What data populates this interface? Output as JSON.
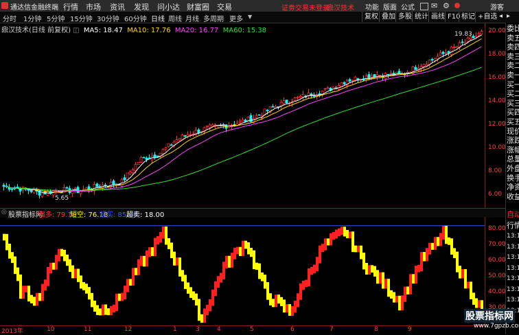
{
  "menubar": {
    "app_title": "通达信金融终端",
    "menus": [
      "行情",
      "市场",
      "资讯",
      "发现",
      "问小达",
      "财富圈",
      "交易"
    ],
    "warning": "证劵交易未登录",
    "indicator_name": "鼎汉技术",
    "right_items": [
      "功能",
      "版面",
      "公式"
    ],
    "guest": "游客"
  },
  "toolbar": {
    "periods": [
      "分时",
      "1分钟",
      "5分钟",
      "15分钟",
      "30分钟",
      "60分钟",
      "日线",
      "周线",
      "月线",
      "多周期",
      "更多"
    ],
    "active_period": "日线",
    "buttons": [
      "复权",
      "叠加",
      "多股",
      "统计",
      "画线",
      "F10",
      "标记",
      "+自选"
    ]
  },
  "chart": {
    "title": "鼎汉技术(日线 前复权)",
    "ma": [
      {
        "label": "MA5: 18.47",
        "color": "#ffffff"
      },
      {
        "label": "MA10: 17.76",
        "color": "#ffd700"
      },
      {
        "label": "MA20: 16.77",
        "color": "#ff44ff"
      },
      {
        "label": "MA60: 15.38",
        "color": "#33dd33"
      }
    ],
    "high_label": "19.83",
    "low_label": "5.65",
    "price_ticks": [
      "20.00",
      "18.00",
      "16.00",
      "14.00",
      "12.00",
      "10.00",
      "8.00",
      "6.00"
    ],
    "colors": {
      "up": "#ff3030",
      "down": "#00ffff",
      "ma5": "#ffffff",
      "ma10": "#ffd700",
      "ma20": "#ff44ff",
      "ma60": "#33dd33"
    }
  },
  "indicator": {
    "name": "股票指标网",
    "values": [
      {
        "label": "强多: 79.16",
        "color": "#ff3030"
      },
      {
        "label": "短空: 76.18",
        "color": "#ffff00"
      },
      {
        "label": "超买: 85.00",
        "color": "#3355ff"
      },
      {
        "label": "超卖: 18.00",
        "color": "#ffffff"
      }
    ],
    "ticks": [
      "80.00",
      "70.00",
      "60.00",
      "50.00",
      "40.00",
      "30.00"
    ]
  },
  "side_panel": {
    "items": [
      "委比",
      "卖五",
      "卖四",
      "卖三",
      "卖二",
      "卖一",
      "买一",
      "买二",
      "买三",
      "买四",
      "买五",
      "现价",
      "涨跌",
      "涨幅",
      "总量",
      "外盘",
      "换手",
      "净资",
      "收益"
    ],
    "bottom_items": [
      "自动",
      "行情",
      "13:11",
      "13:11",
      "13:11",
      "13:11",
      "13:11",
      "13:11",
      "13:11",
      "13:11"
    ]
  },
  "time_axis": {
    "labels": [
      "2013年",
      "10",
      "11",
      "12",
      "1",
      "3",
      "4",
      "5",
      "6",
      "7",
      "8",
      "9"
    ]
  },
  "watermark": {
    "title": "股票指标网",
    "url": "www.7gpzb.com"
  }
}
